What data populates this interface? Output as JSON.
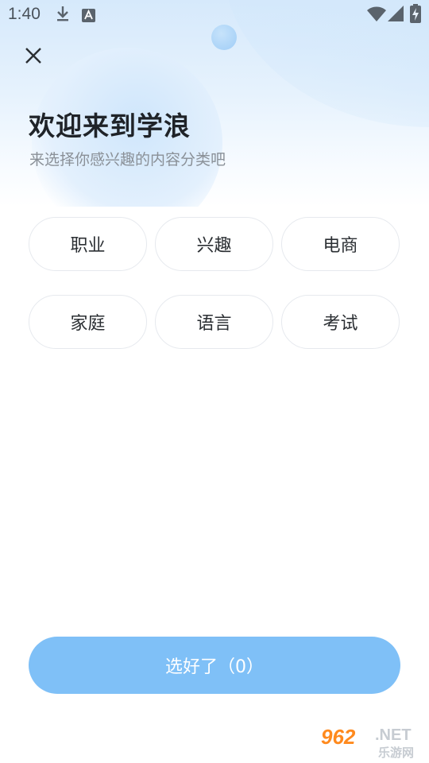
{
  "status_bar": {
    "time": "1:40",
    "icons": [
      "download-icon",
      "a-notification-icon",
      "wifi-icon",
      "signal-icon",
      "battery-charging-icon"
    ]
  },
  "header": {
    "close_icon": "close-icon",
    "title": "欢迎来到学浪",
    "subtitle": "来选择你感兴趣的内容分类吧"
  },
  "categories": [
    {
      "label": "职业"
    },
    {
      "label": "兴趣"
    },
    {
      "label": "电商"
    },
    {
      "label": "家庭"
    },
    {
      "label": "语言"
    },
    {
      "label": "考试"
    }
  ],
  "confirm_button": {
    "label": "选好了（0）",
    "color": "#7fc0f7"
  },
  "watermark": {
    "number": "962",
    "suffix": ".NET",
    "cn": "乐游网"
  },
  "colors": {
    "accent": "#7fc0f7",
    "title": "#1f2328",
    "subtitle": "#8a9097"
  }
}
